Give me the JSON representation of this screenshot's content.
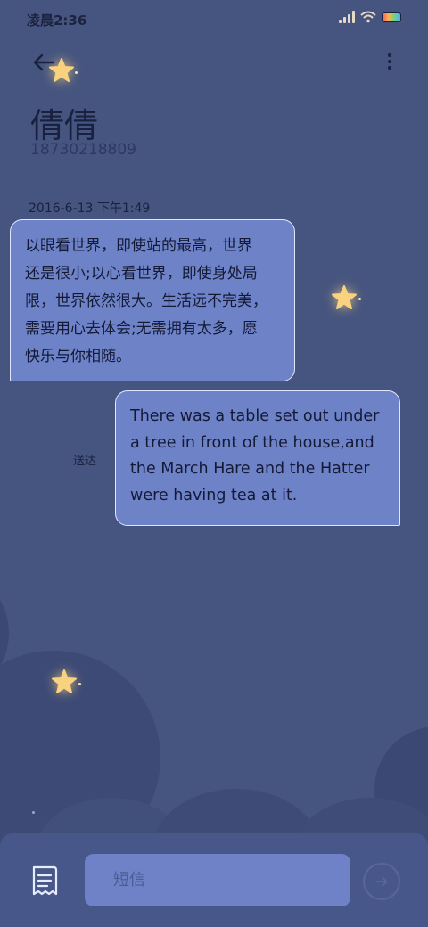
{
  "status_bar": {
    "time": "凌晨2:36",
    "icons": [
      "signal-icon",
      "wifi-icon",
      "battery-icon"
    ]
  },
  "header": {
    "back_icon": "back-arrow-icon",
    "menu_icon": "more-vertical-icon"
  },
  "contact": {
    "name": "倩倩",
    "number": "18730218809"
  },
  "conversation": {
    "timestamp": "2016-6-13 下午1:49",
    "messages": [
      {
        "direction": "incoming",
        "lines": [
          "以眼看世界，即使站的最高，世界",
          "还是很小;以心看世界，即使身处局",
          "限，世界依然很大。生活远不完美，",
          "需要用心去体会;无需拥有太多，愿",
          "快乐与你相随。"
        ]
      },
      {
        "direction": "outgoing",
        "lines": [
          "There was a table set out under",
          "a tree in front of the house,and",
          "the March Hare and the Hatter",
          "were having tea at it."
        ],
        "status": "送达"
      }
    ]
  },
  "composer": {
    "placeholder": "短信",
    "template_icon": "message-template-icon",
    "send_icon": "send-icon"
  },
  "colors": {
    "background": "#46557f",
    "bubble": "#6e82c8",
    "input": "#6f82c7",
    "star": "#f8d27e"
  }
}
